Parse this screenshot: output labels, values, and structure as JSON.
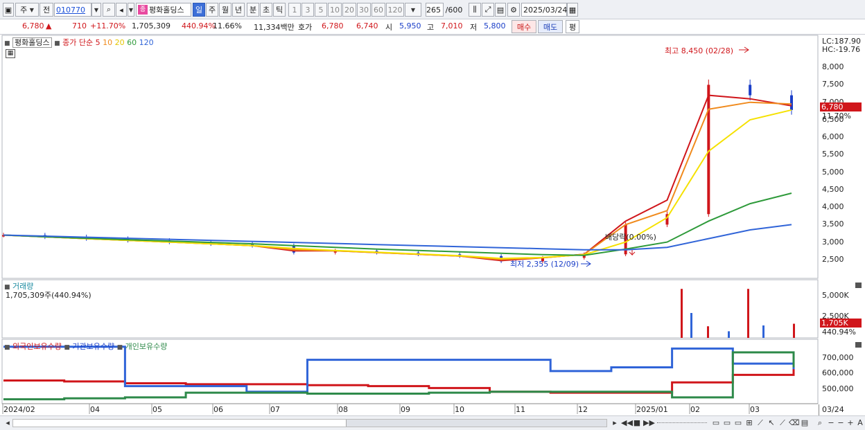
{
  "toolbar": {
    "mode": "주",
    "prev": "전",
    "code": "010770",
    "name": "평화홀딩스",
    "name_badge": "종",
    "periods": [
      "일",
      "주",
      "월",
      "년",
      "분",
      "초",
      "틱"
    ],
    "selected_period": "일",
    "minutes": [
      "1",
      "3",
      "5",
      "10",
      "20",
      "30",
      "60",
      "120"
    ],
    "count": "265",
    "count_total": "/600",
    "date": "2025/03/24"
  },
  "quote": {
    "price": "6,780",
    "arrow": "▲",
    "change": "710",
    "change_pct": "+11.70%",
    "volume": "1,705,309",
    "volume_ratio": "440.94%",
    "turnover": "11.66%",
    "amount": "11,334백만",
    "bid_label": "호가",
    "ask": "6,780",
    "bid": "6,740",
    "open_label": "시",
    "open": "5,950",
    "high_label": "고",
    "high": "7,010",
    "low_label": "저",
    "low": "5,800",
    "buy": "매수",
    "sell": "매도",
    "avg": "평"
  },
  "price_panel": {
    "legend_name": "평화홀딩스",
    "legend_close": "종가 단순",
    "ma_labels": [
      "5",
      "10",
      "20",
      "60",
      "120"
    ],
    "lc": "LC:187.90",
    "hc": "HC:-19.76",
    "y_ticks": [
      "8,000",
      "7,500",
      "7,000",
      "6,500",
      "6,000",
      "5,500",
      "5,000",
      "4,500",
      "4,000",
      "3,500",
      "3,000",
      "2,500"
    ],
    "current_tag": "6,780",
    "current_pct": "11.70%",
    "high_note": "최고 8,450 (02/28)",
    "low_note": "최저 2,355 (12/09)",
    "dividend_note": "배당락(0.00%)"
  },
  "volume_panel": {
    "title": "거래량",
    "value": "1,705,309주(440.94%)",
    "y_ticks": [
      "5,000K",
      "2,500K"
    ],
    "current_tag": "1,705K",
    "current_pct": "440.94%"
  },
  "holding_panel": {
    "legend": [
      "외국인보유수량",
      "기관보유수량",
      "개인보유수량"
    ],
    "y_ticks": [
      "700,000",
      "600,000",
      "500,000"
    ]
  },
  "x_axis": [
    "2024/02",
    "04",
    "05",
    "06",
    "07",
    "08",
    "09",
    "10",
    "11",
    "12",
    "2025/01",
    "02",
    "03"
  ],
  "x_axis_right": "03/24",
  "chart_data": [
    {
      "type": "line",
      "title": "평화홀딩스",
      "series": [
        {
          "name": "종가",
          "values": [
            3200,
            3150,
            3100,
            3050,
            3000,
            2950,
            2900,
            2700,
            2750,
            2700,
            2650,
            2600,
            2450,
            2550,
            2650,
            3500,
            3800,
            7500,
            7200,
            6780
          ]
        },
        {
          "name": "5",
          "values": [
            3200,
            3150,
            3100,
            3050,
            3000,
            2950,
            2900,
            2750,
            2750,
            2700,
            2650,
            2600,
            2470,
            2550,
            2650,
            3600,
            4200,
            7200,
            7100,
            6900
          ]
        },
        {
          "name": "10",
          "values": [
            3200,
            3150,
            3100,
            3050,
            3000,
            2950,
            2900,
            2780,
            2750,
            2700,
            2650,
            2600,
            2500,
            2550,
            2650,
            3500,
            3900,
            6800,
            7000,
            6950
          ]
        },
        {
          "name": "20",
          "values": [
            3200,
            3150,
            3100,
            3050,
            3000,
            2950,
            2900,
            2820,
            2760,
            2710,
            2660,
            2610,
            2530,
            2560,
            2640,
            3000,
            3700,
            5600,
            6500,
            6780
          ]
        },
        {
          "name": "60",
          "values": [
            3200,
            3150,
            3110,
            3070,
            3030,
            2990,
            2950,
            2900,
            2850,
            2800,
            2760,
            2720,
            2680,
            2640,
            2620,
            2800,
            3000,
            3600,
            4100,
            4400
          ]
        },
        {
          "name": "120",
          "values": [
            3200,
            3170,
            3140,
            3110,
            3080,
            3050,
            3020,
            2990,
            2960,
            2930,
            2900,
            2870,
            2840,
            2810,
            2780,
            2780,
            2850,
            3100,
            3350,
            3500
          ]
        }
      ],
      "ylim": [
        2200,
        8500
      ]
    },
    {
      "type": "bar",
      "title": "거래량",
      "categories": [
        "2025/01 late",
        "02 early",
        "02 mid",
        "02 late",
        "03 early",
        "03 mid",
        "03/24"
      ],
      "values": [
        5900,
        3000,
        1400,
        800,
        5900,
        1500,
        1705
      ],
      "ylim": [
        0,
        6000
      ]
    },
    {
      "type": "line",
      "series": [
        {
          "name": "외국인보유수량",
          "values": [
            570000,
            565000,
            555000,
            550000,
            550000,
            545000,
            540000,
            530000,
            510000,
            505000,
            505000,
            560000,
            600000,
            650000
          ]
        },
        {
          "name": "기관보유수량",
          "values": [
            750000,
            750000,
            540000,
            540000,
            510000,
            680000,
            680000,
            680000,
            680000,
            620000,
            640000,
            740000,
            660000,
            630000
          ]
        },
        {
          "name": "개인보유수량",
          "values": [
            470000,
            475000,
            480000,
            505000,
            505000,
            500000,
            500000,
            505000,
            510000,
            510000,
            510000,
            480000,
            720000,
            640000
          ]
        }
      ],
      "ylim": [
        450000,
        760000
      ]
    }
  ]
}
